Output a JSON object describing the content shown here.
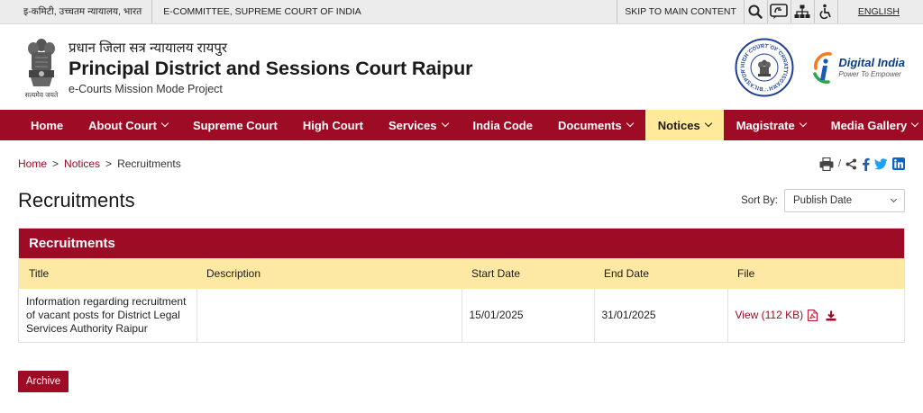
{
  "topbar": {
    "hindi_link": "इ-कमिटी, उच्चतम न्यायालय, भारत",
    "ecommittee_link": "E-COMMITTEE, SUPREME COURT OF INDIA",
    "skip_link": "SKIP TO MAIN CONTENT",
    "language": "ENGLISH",
    "icons": [
      "search-icon",
      "sign-language-icon",
      "sitemap-icon",
      "accessibility-icon"
    ]
  },
  "header": {
    "emblem_motto": "सत्यमेव जयते",
    "title_hindi": "प्रधान जिला सत्र न्यायालय रायपुर",
    "title": "Principal District and Sessions Court Raipur",
    "subtitle": "e-Courts Mission Mode Project",
    "digital_india": "Digital India",
    "digital_india_tagline": "Power To Empower",
    "seal_text": "HIGH COURT OF CHHATTISGARH · BILASPUR"
  },
  "nav": {
    "items": [
      {
        "label": "Home",
        "dropdown": false
      },
      {
        "label": "About Court",
        "dropdown": true
      },
      {
        "label": "Supreme Court",
        "dropdown": false
      },
      {
        "label": "High Court",
        "dropdown": false
      },
      {
        "label": "Services",
        "dropdown": true
      },
      {
        "label": "India Code",
        "dropdown": false
      },
      {
        "label": "Documents",
        "dropdown": true
      },
      {
        "label": "Notices",
        "dropdown": true,
        "active": true
      },
      {
        "label": "Magistrate",
        "dropdown": true
      },
      {
        "label": "Media Gallery",
        "dropdown": true
      }
    ]
  },
  "breadcrumb": {
    "home": "Home",
    "notices": "Notices",
    "separator": ">",
    "current": "Recruitments"
  },
  "share": {
    "separator": "/",
    "icons": [
      "print-icon",
      "share-icon",
      "facebook-icon",
      "twitter-icon",
      "linkedin-icon"
    ]
  },
  "page": {
    "title": "Recruitments",
    "sort_label": "Sort By:",
    "sort_value": "Publish Date"
  },
  "panel": {
    "heading": "Recruitments",
    "columns": [
      "Title",
      "Description",
      "Start Date",
      "End Date",
      "File"
    ],
    "rows": [
      {
        "title": "Information regarding recruitment of vacant posts for District Legal Services Authority Raipur",
        "description": "",
        "start_date": "15/01/2025",
        "end_date": "31/01/2025",
        "file_label": "View (112 KB)"
      }
    ]
  },
  "archive_label": "Archive",
  "colors": {
    "primary": "#9e0b24",
    "active_nav": "#ffe99a",
    "table_header": "#fde9a3",
    "topbar": "#ececec"
  }
}
